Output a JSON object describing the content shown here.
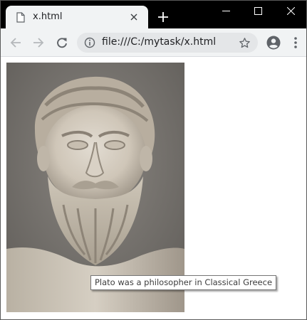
{
  "tab": {
    "title": "x.html"
  },
  "address_bar": {
    "url": "file:///C:/mytask/x.html"
  },
  "content": {
    "image_subject": "marble bust of Plato",
    "tooltip": "Plato was a philosopher in Classical Greece"
  },
  "icons": {
    "favicon": "page-icon",
    "tab_close": "close-icon",
    "new_tab": "plus-icon",
    "back": "arrow-left-icon",
    "forward": "arrow-right-icon",
    "reload": "reload-icon",
    "site_info": "info-icon",
    "bookmark": "star-icon",
    "profile": "account-icon",
    "menu": "more-vert-icon"
  },
  "colors": {
    "titlebar": "#000000",
    "toolbar": "#f1f3f4",
    "omnibox": "#e4e6e8"
  }
}
